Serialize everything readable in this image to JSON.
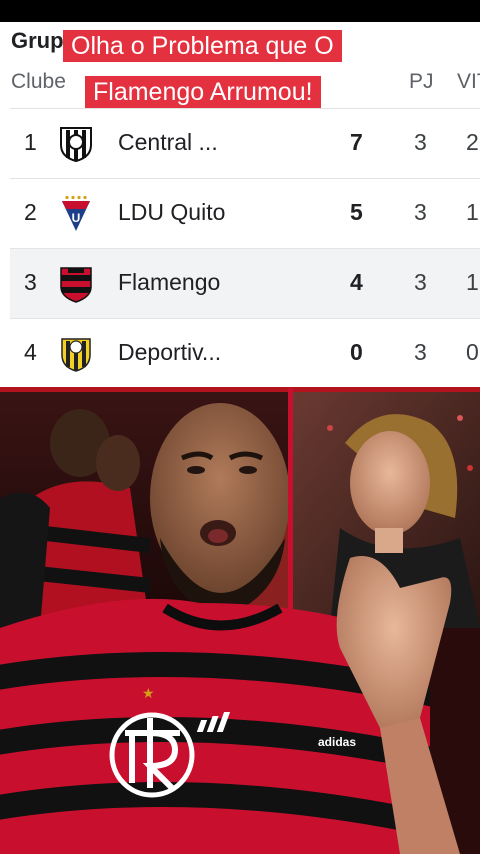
{
  "caption": {
    "line1": "Olha o Problema que O",
    "line2": "Flamengo Arrumou!"
  },
  "table": {
    "group_title": "Grupo",
    "headers": {
      "club": "Clube",
      "pj": "PJ",
      "vit": "VIT"
    },
    "rows": [
      {
        "pos": "1",
        "name": "Central ...",
        "pts": "7",
        "pj": "3",
        "vit": "2",
        "crest": "central-crest-icon"
      },
      {
        "pos": "2",
        "name": "LDU Quito",
        "pts": "5",
        "pj": "3",
        "vit": "1",
        "crest": "ldu-crest-icon"
      },
      {
        "pos": "3",
        "name": "Flamengo",
        "pts": "4",
        "pj": "3",
        "vit": "1",
        "crest": "flamengo-crest-icon"
      },
      {
        "pos": "4",
        "name": "Deportiv...",
        "pts": "0",
        "pj": "3",
        "vit": "0",
        "crest": "deportivo-crest-icon"
      }
    ]
  },
  "jersey": {
    "sponsor": "adidas"
  },
  "colors": {
    "caption_bg": "#e4313f",
    "flamengo_red": "#c8102e",
    "flamengo_black": "#111111"
  }
}
